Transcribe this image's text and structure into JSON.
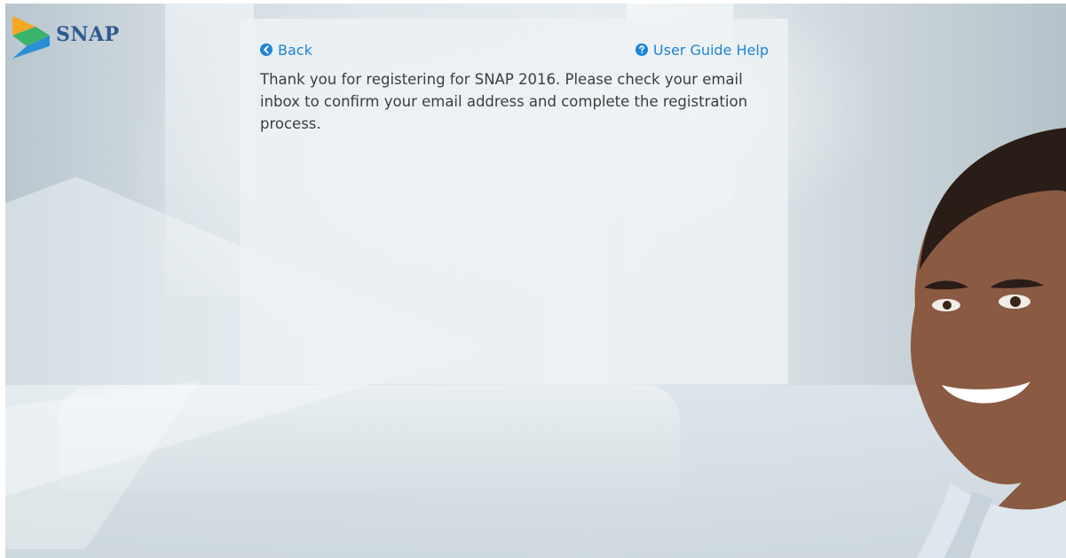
{
  "brand": {
    "name": "SNAP"
  },
  "nav": {
    "back_label": "Back",
    "help_label": "User Guide Help"
  },
  "content": {
    "message": "Thank you for registering for SNAP 2016. Please check your email inbox to confirm your email address and complete the registration process."
  },
  "icons": {
    "back": "chevron-circle-left-icon",
    "help": "question-circle-icon",
    "logo": "snap-logo-icon"
  },
  "colors": {
    "link": "#1d84d8",
    "logo_text": "#2d5a8e",
    "logo_orange": "#f5a623",
    "logo_green": "#3bb36b",
    "logo_blue": "#2b8fd6"
  }
}
